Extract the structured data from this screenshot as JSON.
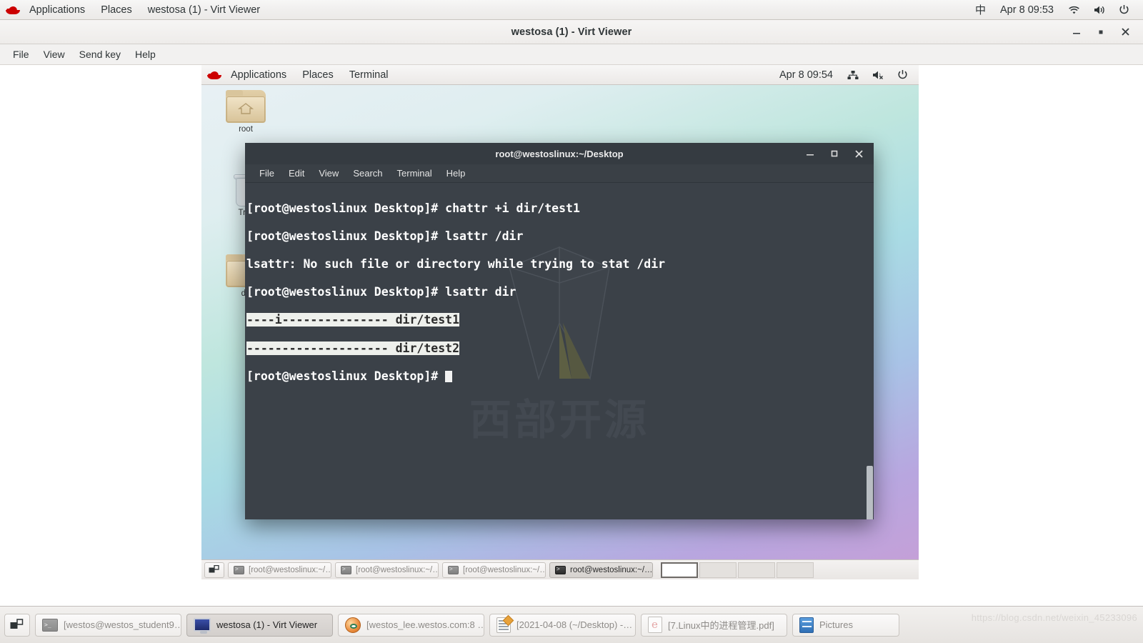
{
  "host": {
    "topbar": {
      "logo": "redhat-logo",
      "menus": [
        "Applications",
        "Places"
      ],
      "window_title": "westosa (1) - Virt Viewer",
      "input_method": "中",
      "clock": "Apr 8  09:53",
      "indicators": [
        "wifi-icon",
        "volume-icon",
        "power-icon"
      ]
    },
    "taskbar": {
      "show_desktop": "show-desktop-icon",
      "items": [
        {
          "label": "[westos@westos_student9…",
          "icon": "terminal-icon",
          "active": false
        },
        {
          "label": "westosa (1) - Virt Viewer",
          "icon": "monitor-icon",
          "active": true
        },
        {
          "label": "[westos_lee.westos.com:8 …",
          "icon": "browser-icon",
          "active": false
        },
        {
          "label": "[2021-04-08 (~/Desktop) -…",
          "icon": "notes-icon",
          "active": false
        },
        {
          "label": "[7.Linux中的进程管理.pdf]",
          "icon": "pdf-icon",
          "active": false
        },
        {
          "label": "Pictures",
          "icon": "files-icon",
          "active": false
        }
      ]
    },
    "watermark_url": "https://blog.csdn.net/weixin_45233096"
  },
  "virt_viewer": {
    "title": "westosa (1) - Virt Viewer",
    "window_buttons": {
      "minimize": "–",
      "maximize": "◻",
      "close": "✕"
    },
    "menus": [
      "File",
      "View",
      "Send key",
      "Help"
    ]
  },
  "vm": {
    "topbar": {
      "logo": "redhat-logo",
      "menus": [
        "Applications",
        "Places",
        "Terminal"
      ],
      "clock": "Apr 8  09:54",
      "indicators": [
        "network-icon",
        "volume-muted-icon",
        "power-icon"
      ]
    },
    "desktop_icons": [
      {
        "label": "root",
        "icon": "home-folder-icon"
      },
      {
        "label": "Trash",
        "icon": "trash-icon"
      },
      {
        "label": "dir",
        "icon": "folder-icon"
      }
    ],
    "taskbar": {
      "show_desktop": "show-desktop-icon",
      "items": [
        {
          "label": "[root@westoslinux:~/…",
          "active": false
        },
        {
          "label": "[root@westoslinux:~/…",
          "active": false
        },
        {
          "label": "[root@westoslinux:~/…",
          "active": false
        },
        {
          "label": "root@westoslinux:~/…",
          "active": true
        }
      ],
      "workspaces": [
        {
          "active": true
        },
        {
          "active": false
        },
        {
          "active": false
        },
        {
          "active": false
        }
      ]
    }
  },
  "terminal": {
    "title": "root@westoslinux:~/Desktop",
    "window_buttons": {
      "minimize": "–",
      "maximize": "◻",
      "close": "✕"
    },
    "menus": [
      "File",
      "Edit",
      "View",
      "Search",
      "Terminal",
      "Help"
    ],
    "prompt": "[root@westoslinux Desktop]# ",
    "watermark": {
      "logo": "westos-logo",
      "text": "西部开源"
    },
    "lines": [
      {
        "text": "[root@westoslinux Desktop]# chattr +i dir/test1",
        "highlight": false
      },
      {
        "text": "[root@westoslinux Desktop]# lsattr /dir",
        "highlight": false
      },
      {
        "text": "lsattr: No such file or directory while trying to stat /dir",
        "highlight": false
      },
      {
        "text": "[root@westoslinux Desktop]# lsattr dir",
        "highlight": false
      },
      {
        "text": "----i--------------- dir/test1",
        "highlight": true
      },
      {
        "text": "-------------------- dir/test2",
        "highlight": true
      },
      {
        "text": "[root@westoslinux Desktop]# ",
        "highlight": false,
        "cursor": true
      }
    ]
  },
  "colors": {
    "redhat_red": "#cc0000",
    "terminal_bg": "#3b4148",
    "terminal_titlebar": "#353b41",
    "terminal_menubar": "#3a4046",
    "terminal_text": "#ffffff",
    "highlight_bg": "#eef0ec",
    "highlight_fg": "#2b2b2b",
    "panel_bg": "#f1efee"
  }
}
